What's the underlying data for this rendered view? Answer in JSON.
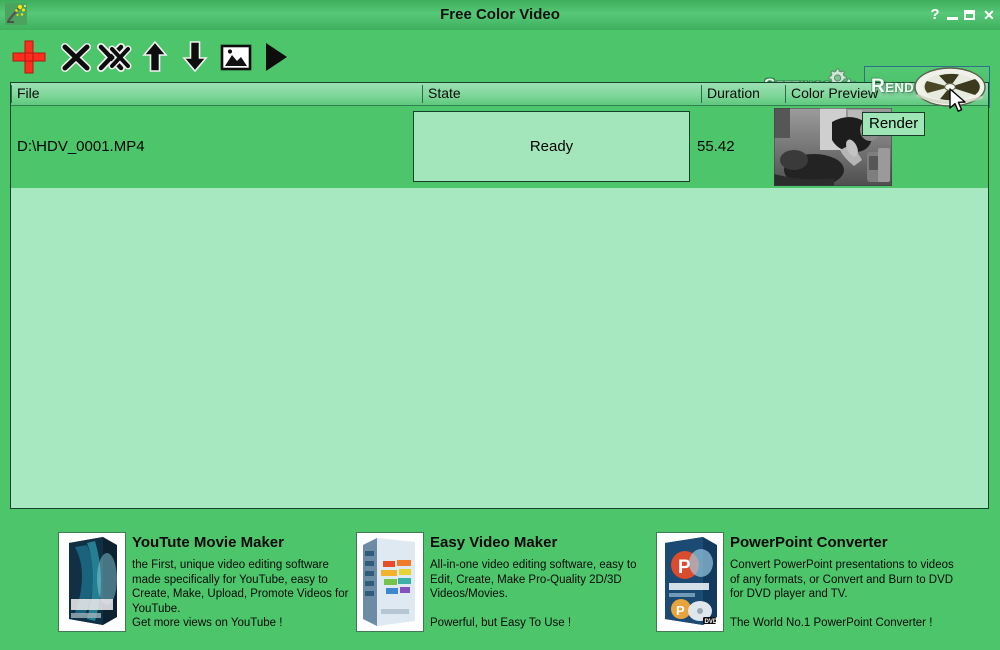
{
  "window": {
    "title": "Free Color Video",
    "app_icon": "magic-wand-icon",
    "controls": {
      "help": "?",
      "minimize": "minimize-icon",
      "maximize": "maximize-icon",
      "close": "✕"
    }
  },
  "toolbar": {
    "items": [
      {
        "name": "add-file-button",
        "icon": "plus-icon"
      },
      {
        "name": "remove-file-button",
        "icon": "x-icon"
      },
      {
        "name": "remove-all-files-button",
        "icon": "double-x-icon"
      },
      {
        "name": "move-up-button",
        "icon": "arrow-up-icon"
      },
      {
        "name": "move-down-button",
        "icon": "arrow-down-icon"
      },
      {
        "name": "preview-image-button",
        "icon": "image-icon"
      },
      {
        "name": "play-button",
        "icon": "play-triangle-icon"
      }
    ],
    "settings_label": "Settings",
    "render_label": "Render",
    "render_tooltip": "Render"
  },
  "list": {
    "columns": [
      {
        "key": "file",
        "label": "File"
      },
      {
        "key": "state",
        "label": "State"
      },
      {
        "key": "dur",
        "label": "Duration"
      },
      {
        "key": "color",
        "label": "Color Preview"
      }
    ],
    "rows": [
      {
        "file": "D:\\HDV_0001.MP4",
        "state": "Ready",
        "duration": "55.42",
        "color_preview": "video-thumbnail"
      }
    ]
  },
  "promos": [
    {
      "name": "youtube-movie-maker",
      "title": "YouTute Movie Maker",
      "description": "the First, unique video editing software made specifically for YouTube, easy to Create, Make, Upload, Promote Videos for YouTube.",
      "tagline": "Get more views on YouTube !"
    },
    {
      "name": "easy-video-maker",
      "title": "Easy Video Maker",
      "description": "All-in-one video editing software, easy to Edit, Create, Make Pro-Quality 2D/3D Videos/Movies.",
      "tagline": "Powerful, but Easy To Use !"
    },
    {
      "name": "powerpoint-converter",
      "title": "PowerPoint Converter",
      "description": "Convert PowerPoint presentations to videos of any formats, or Convert and Burn to DVD for DVD player and TV.",
      "tagline": "The World No.1 PowerPoint Converter !"
    }
  ],
  "colors": {
    "app_green": "#4CC56B",
    "titlebar_green": "#56C877",
    "list_background": "#A8E8C0",
    "cell_light": "#A3E6BB",
    "border_dark": "#14452C",
    "accent_red": "#FF2D1E"
  }
}
